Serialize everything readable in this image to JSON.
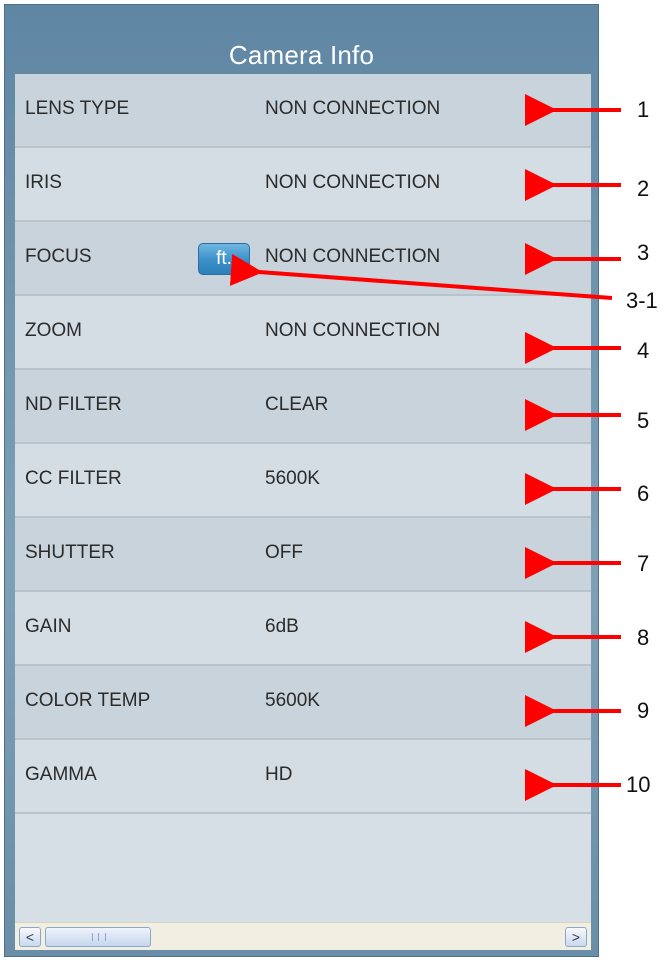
{
  "title": "Camera Info",
  "rows": [
    {
      "label": "LENS TYPE",
      "value": "NON CONNECTION",
      "callout": "1"
    },
    {
      "label": "IRIS",
      "value": "NON CONNECTION",
      "callout": "2"
    },
    {
      "label": "FOCUS",
      "value": "NON CONNECTION",
      "callout": "3"
    },
    {
      "label": "ZOOM",
      "value": "NON CONNECTION",
      "callout": "4"
    },
    {
      "label": "ND FILTER",
      "value": "CLEAR",
      "callout": "5"
    },
    {
      "label": "CC FILTER",
      "value": "5600K",
      "callout": "6"
    },
    {
      "label": "SHUTTER",
      "value": "OFF",
      "callout": "7"
    },
    {
      "label": "GAIN",
      "value": "6dB",
      "callout": "8"
    },
    {
      "label": "COLOR TEMP",
      "value": "5600K",
      "callout": "9"
    },
    {
      "label": "GAMMA",
      "value": "HD",
      "callout": "10"
    }
  ],
  "focus_button": {
    "label": "ft.",
    "callout": "3-1"
  },
  "scrollbar": {
    "left_icon": "chevron-left-icon",
    "right_icon": "chevron-right-icon",
    "left_glyph": "<",
    "right_glyph": ">"
  },
  "colors": {
    "arrow": "#ff0000",
    "panel": "#6f94ad",
    "button": "#3b8fc8"
  }
}
